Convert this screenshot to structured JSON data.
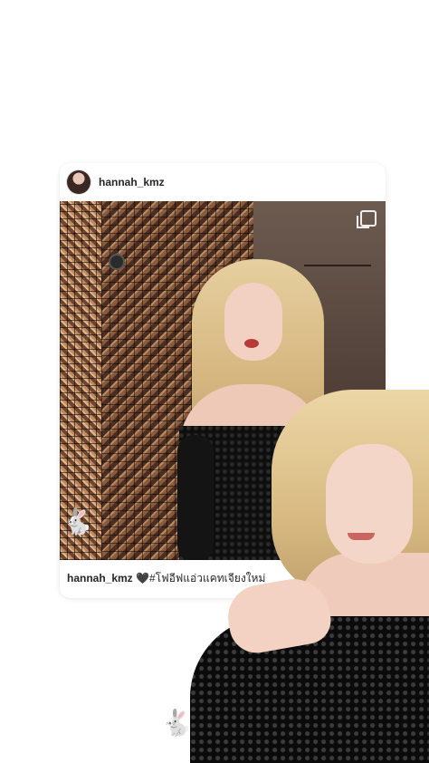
{
  "post": {
    "username": "hannah_kmz",
    "caption": {
      "user": "hannah_kmz",
      "heart": "🖤",
      "text": "#โฟอีฟแอ่วแคทเจียงใหม่"
    }
  },
  "icons": {
    "avatar": "profile-avatar",
    "multi": "multiple-photos-icon",
    "sticker": "🐇"
  },
  "colors": {
    "card_bg": "#ffffff",
    "text": "#262626"
  }
}
